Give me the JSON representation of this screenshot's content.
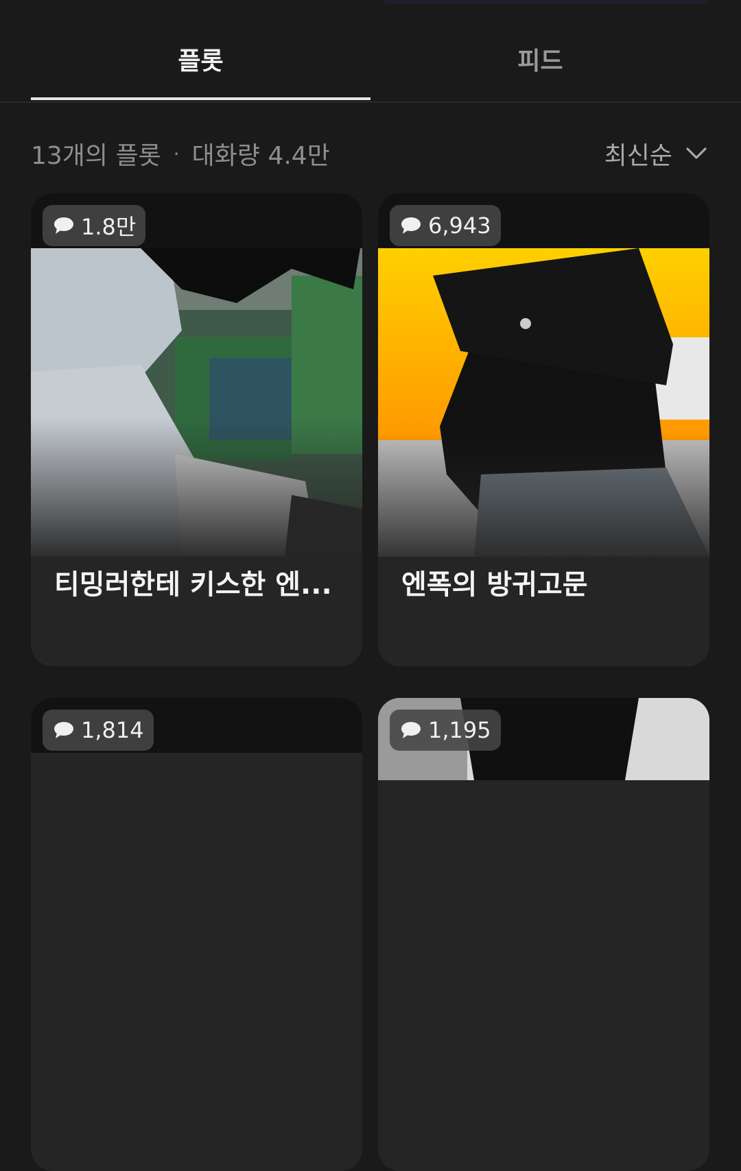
{
  "tabs": {
    "plot_label": "플롯",
    "feed_label": "피드"
  },
  "summary": {
    "count_text": "13개의 플롯",
    "separator": "·",
    "conversations_text": "대화량 4.4만"
  },
  "sort": {
    "label": "최신순",
    "icon": "chevron-down-icon"
  },
  "cards": [
    {
      "count": "1.8만",
      "title": "티밍러한테 키스한 엔..."
    },
    {
      "count": "6,943",
      "title": "엔폭의 방귀고문"
    },
    {
      "count": "1,814",
      "title": ""
    },
    {
      "count": "1,195",
      "title": ""
    }
  ],
  "colors": {
    "background": "#1a1a1a",
    "card": "#252525",
    "badge": "#464646",
    "text_primary": "#f2f2f2",
    "text_secondary": "#8e8e8e"
  }
}
